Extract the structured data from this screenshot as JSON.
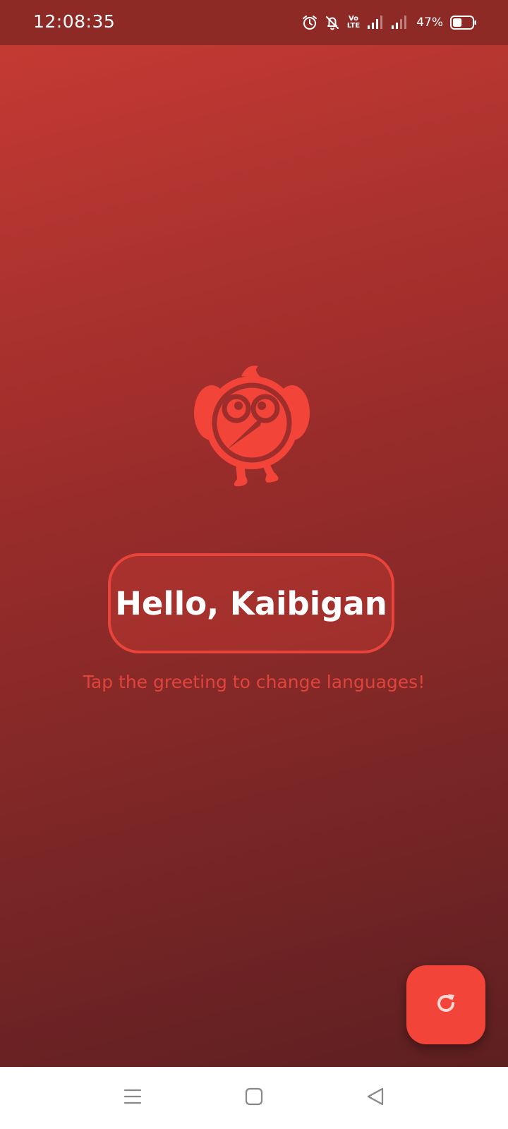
{
  "status_bar": {
    "time": "12:08:35",
    "volte_top": "Vo",
    "volte_bottom": "LTE",
    "battery_percent": "47%",
    "battery_level": 0.47
  },
  "main": {
    "greeting": "Hello, Kaibigan",
    "hint": "Tap the greeting to change languages!"
  },
  "fab": {
    "icon": "refresh-icon"
  },
  "nav": {
    "icons": [
      "menu-icon",
      "home-icon",
      "back-icon"
    ]
  },
  "colors": {
    "accent": "#f24439",
    "status_bar": "#8e2a26",
    "gradient_top": "#c43a33",
    "gradient_bottom": "#5e1f21",
    "hint_text": "#e0443b"
  }
}
